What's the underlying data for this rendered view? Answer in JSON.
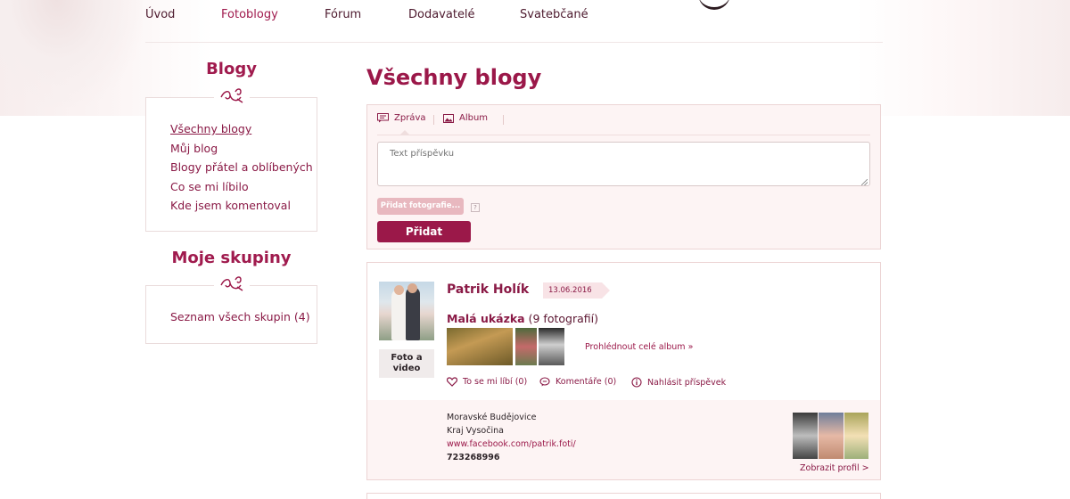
{
  "nav": {
    "items": [
      {
        "label": "Úvod",
        "active": false
      },
      {
        "label": "Fotoblogy",
        "active": true
      },
      {
        "label": "Fórum",
        "active": false
      },
      {
        "label": "Dodavatelé",
        "active": false
      },
      {
        "label": "Svatebčané",
        "active": false
      }
    ]
  },
  "sidebar": {
    "blogs_title": "Blogy",
    "blog_links": [
      {
        "label": "Všechny blogy",
        "current": true
      },
      {
        "label": "Můj blog",
        "current": false
      },
      {
        "label": "Blogy přátel a oblíbených",
        "current": false
      },
      {
        "label": "Co se mi líbilo",
        "current": false
      },
      {
        "label": "Kde jsem komentoval",
        "current": false
      }
    ],
    "groups_title": "Moje skupiny",
    "group_links": [
      {
        "label": "Seznam všech skupin (4)"
      }
    ]
  },
  "main": {
    "title": "Všechny blogy",
    "composer": {
      "tab_message": "Zpráva",
      "tab_album": "Album",
      "text_placeholder": "Text příspěvku",
      "add_photos_label": "Přidat fotografie...",
      "help_label": "?",
      "submit_label": "Přidat"
    },
    "post": {
      "author": "Patrik Holík",
      "date": "13.06.2016",
      "photo_video_label": "Foto a video",
      "album_name": "Malá ukázka",
      "album_count": "(9 fotografií)",
      "view_album_label": "Prohlédnout celé album »",
      "like_label": "To se mi líbí (0)",
      "comments_label": "Komentáře (0)",
      "report_label": "Nahlásit příspěvek",
      "location_city": "Moravské Budějovice",
      "location_region": "Kraj Vysočina",
      "website": "www.facebook.com/patrik.foti/",
      "phone": "723268996",
      "profile_link_label": "Zobrazit profil >"
    }
  },
  "colors": {
    "accent": "#9b1849",
    "accent_light": "#e8b8bf",
    "panel_bg": "#fdf4f4",
    "border": "#ecd4d4"
  }
}
